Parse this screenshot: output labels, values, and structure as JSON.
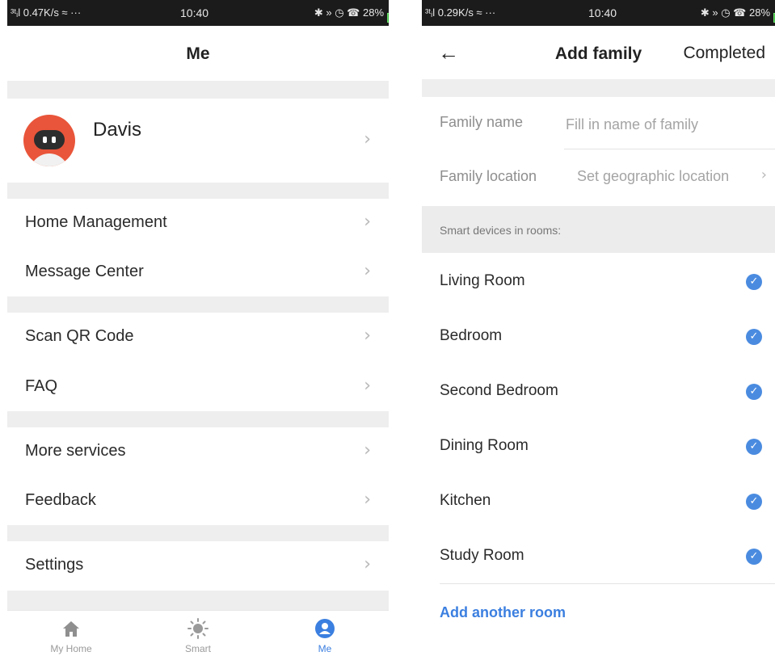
{
  "left": {
    "status": {
      "left": "³ᵗᵢl 0.47K/s ≈ ···",
      "time": "10:40",
      "right": "✱ » ◷ ☎ 28%"
    },
    "title": "Me",
    "profile": {
      "name": "Davis"
    },
    "menu": {
      "home_management": "Home Management",
      "message_center": "Message Center",
      "scan_qr": "Scan QR Code",
      "faq": "FAQ",
      "more_services": "More services",
      "feedback": "Feedback",
      "settings": "Settings"
    },
    "tabs": {
      "my_home": "My Home",
      "smart": "Smart",
      "me": "Me"
    }
  },
  "right": {
    "status": {
      "left": "³ᵗᵢl 0.29K/s ≈ ···",
      "time": "10:40",
      "right": "✱ » ◷ ☎ 28%"
    },
    "title": "Add family",
    "completed": "Completed",
    "family_name": {
      "label": "Family name",
      "placeholder": "Fill in name of family"
    },
    "family_location": {
      "label": "Family location",
      "value": "Set geographic location"
    },
    "section_header": "Smart devices in rooms:",
    "rooms": [
      "Living Room",
      "Bedroom",
      "Second Bedroom",
      "Dining Room",
      "Kitchen",
      "Study Room"
    ],
    "add_room": "Add another room"
  },
  "colors": {
    "accent": "#3b7fe0",
    "check": "#4a8be0",
    "avatar": "#e9553a",
    "gap": "#eeeeee"
  },
  "icons": [
    "back-arrow-icon",
    "chevron-right-icon",
    "check-circle-icon",
    "home-icon",
    "sun-icon",
    "user-icon",
    "battery-icon"
  ]
}
